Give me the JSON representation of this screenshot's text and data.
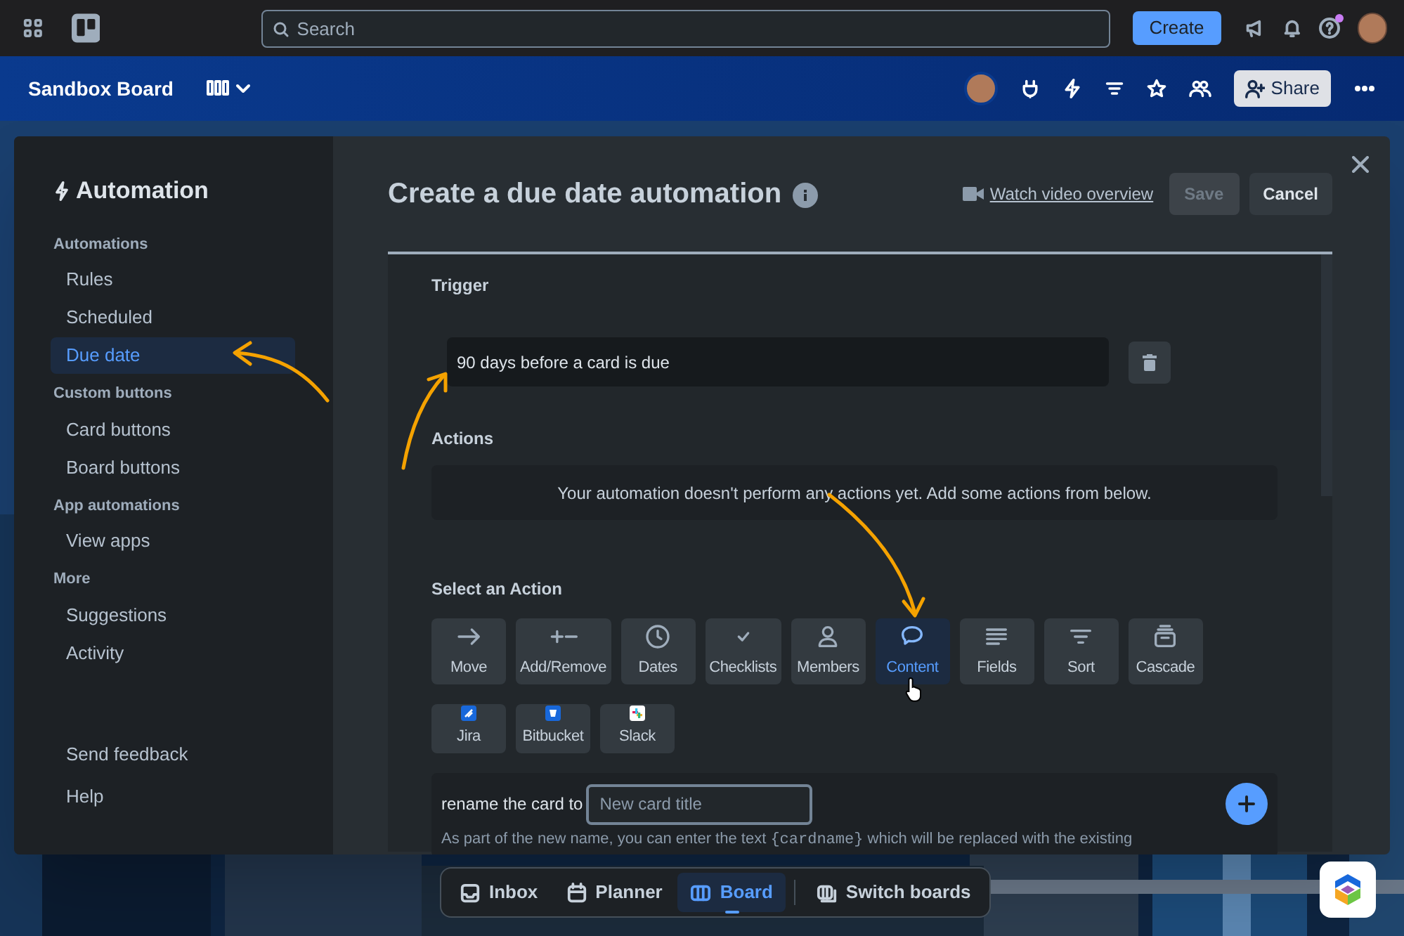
{
  "topbar": {
    "search_placeholder": "Search",
    "create_button": "Create",
    "help_unread": true
  },
  "board": {
    "title": "Sandbox Board",
    "share_button": "Share"
  },
  "automation": {
    "title": "Automation",
    "sections": [
      {
        "heading": "Automations",
        "items": [
          {
            "label": "Rules",
            "selected": false
          },
          {
            "label": "Scheduled",
            "selected": false
          },
          {
            "label": "Due date",
            "selected": true
          }
        ]
      },
      {
        "heading": "Custom buttons",
        "items": [
          {
            "label": "Card buttons",
            "selected": false
          },
          {
            "label": "Board buttons",
            "selected": false
          }
        ]
      },
      {
        "heading": "App automations",
        "items": [
          {
            "label": "View apps",
            "selected": false
          }
        ]
      },
      {
        "heading": "More",
        "items": [
          {
            "label": "Suggestions",
            "selected": false
          },
          {
            "label": "Activity",
            "selected": false
          }
        ]
      }
    ],
    "footer_items": [
      "Send feedback",
      "Help"
    ]
  },
  "editor": {
    "title": "Create a due date automation",
    "video_link": "Watch video overview",
    "save_button": {
      "label": "Save",
      "disabled": true
    },
    "cancel_button": "Cancel",
    "trigger": {
      "heading": "Trigger",
      "text": "90 days before a card is due"
    },
    "actions": {
      "heading": "Actions",
      "empty_message": "Your automation doesn't perform any actions yet. Add some actions from below."
    },
    "select_action": {
      "heading": "Select an Action",
      "options": [
        {
          "label": "Move",
          "selected": false
        },
        {
          "label": "Add/Remove",
          "selected": false
        },
        {
          "label": "Dates",
          "selected": false
        },
        {
          "label": "Checklists",
          "selected": false
        },
        {
          "label": "Members",
          "selected": false
        },
        {
          "label": "Content",
          "selected": true
        },
        {
          "label": "Fields",
          "selected": false
        },
        {
          "label": "Sort",
          "selected": false
        },
        {
          "label": "Cascade",
          "selected": false
        },
        {
          "label": "Jira",
          "selected": false
        },
        {
          "label": "Bitbucket",
          "selected": false
        },
        {
          "label": "Slack",
          "selected": false
        }
      ]
    },
    "rename": {
      "label": "rename the card to",
      "placeholder": "New card title",
      "note": [
        "As part of the new name, you can enter the text",
        "{cardname}",
        "which will be replaced with the existing"
      ]
    }
  },
  "bottom_nav": [
    {
      "label": "Inbox",
      "selected": false
    },
    {
      "label": "Planner",
      "selected": false
    },
    {
      "label": "Board",
      "selected": true
    },
    {
      "label": "Switch boards",
      "selected": false
    }
  ]
}
